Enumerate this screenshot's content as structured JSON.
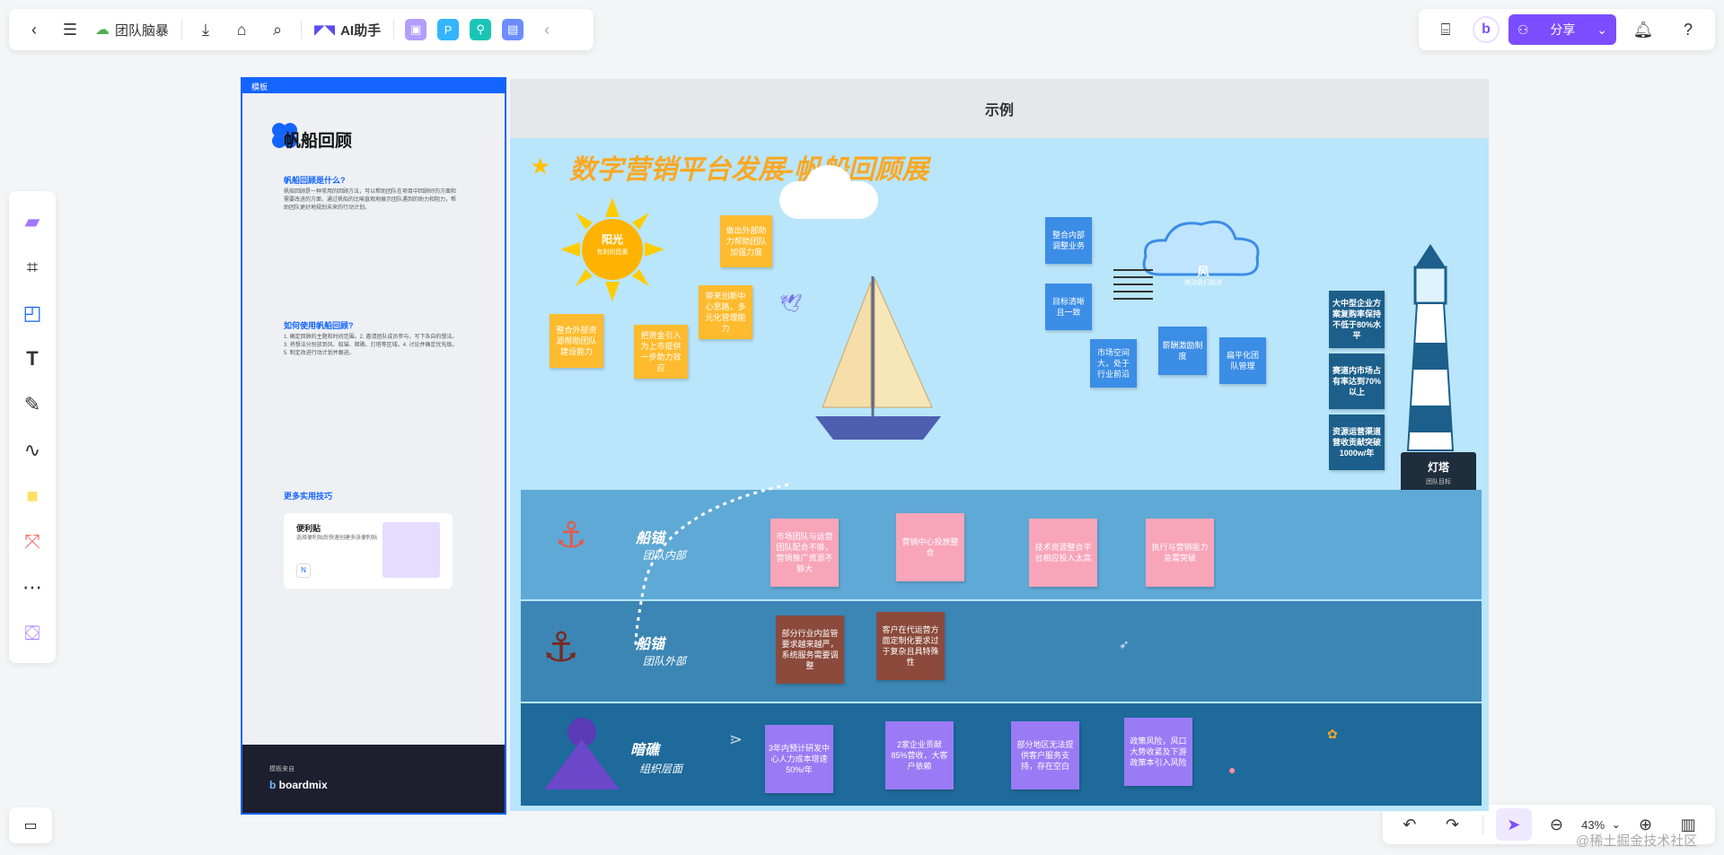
{
  "toolbar": {
    "board_name": "团队脑暴",
    "ai_label": "AI助手",
    "share_label": "分享"
  },
  "bottom": {
    "zoom": "43%"
  },
  "watermark": "@稀土掘金技术社区",
  "template_panel": {
    "header": "模板",
    "title": "帆船回顾",
    "section1": "帆船回顾是什么?",
    "section1_text": "帆船回顾是一种常用的回顾方法，可以帮助团队在项目中回顾好的方面和需要改进的方面，通过帆船的比喻直观地展示团队遇到的助力和阻力，帮助团队更好地规划未来的行动计划。",
    "section2": "如何使用帆船回顾?",
    "section2_text": "1. 确定回顾的主题和时间范围。2. 邀请团队成员参与，写下各自的想法。3. 将想法分别放到风、船锚、暗礁、灯塔等区域。4. 讨论并确定优先级。5. 制定改进行动计划并跟进。",
    "section3": "更多实用技巧",
    "card_title": "便利贴",
    "card_desc": "选择便利贴后快速创建多张便利贴",
    "card_key": "N",
    "footer_small": "模板来自",
    "footer_brand": "boardmix"
  },
  "example": {
    "header": "示例",
    "title": "数字营销平台发展-帆船回顾展",
    "sun_label": "阳光",
    "sun_sub": "有利的因素",
    "wind_label": "风",
    "wind_sub": "推动我们前进",
    "lighthouse_label": "灯塔",
    "lighthouse_sub": "团队目标",
    "anchor1_label": "船锚",
    "anchor1_sub": "团队内部",
    "anchor2_label": "船锚",
    "anchor2_sub": "团队外部",
    "reef_label": "暗礁",
    "reef_sub": "组织层面",
    "yellow_notes": [
      "整合外部资源帮助团队建设能力",
      "把资金引入为上市提供一步助力效应",
      "带来创新中心思路，多元化管理能力",
      "做出外部助力帮助团队加强力度"
    ],
    "blue_notes": [
      "整合内部调整业务",
      "目标清晰且一致",
      "市场空间大，处于行业前沿",
      "薪酬激励制度",
      "扁平化团队管理"
    ],
    "goal_notes": [
      "大中型企业方案复购率保持不低于80%水平",
      "赛道内市场占有率达到70%以上",
      "资源运营渠道营收贡献突破1000w/年"
    ],
    "pink_notes": [
      "市场团队与运营团队配合不够，营销推广资源不够大",
      "营销中心投放整合",
      "技术资源整合平台相应投入太高",
      "执行与营销能力急需突破"
    ],
    "brown_notes": [
      "部分行业内监管要求越来越严，系统服务需要调整",
      "客户在代运营方面定制化要求过于复杂且具特殊性"
    ],
    "violet_notes": [
      "3年内预计研发中心人力成本增速50%/年",
      "2家企业贡献85%营收，大客户依赖",
      "部分地区无法提供客户服务支持，存在空白",
      "政策风险，风口大势收紧及下游政策本引入风险"
    ]
  }
}
